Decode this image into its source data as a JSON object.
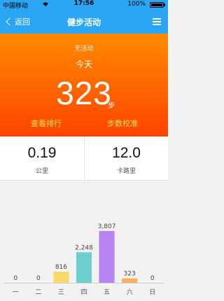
{
  "status_bar": {
    "carrier": "中国移动",
    "time": "17:56",
    "battery_percent": "100%"
  },
  "nav": {
    "back_label": "返回",
    "title": "健步活动"
  },
  "hero": {
    "activity_status": "无活动",
    "day_label": "今天",
    "steps": "323",
    "steps_unit": "步",
    "ranking_link": "查看排行",
    "calibrate_link": "步数校准"
  },
  "stats": {
    "distance_value": "0.19",
    "distance_label": "公里",
    "calories_value": "12.0",
    "calories_label": "卡路里"
  },
  "colors": {
    "nav_blue": "#2aa6f5",
    "hero_top": "#ff8a00",
    "hero_bottom": "#ff4500",
    "link_yellow": "#ffe34d"
  },
  "chart_data": {
    "type": "bar",
    "categories": [
      "一",
      "二",
      "三",
      "四",
      "五",
      "六",
      "日"
    ],
    "values": [
      0,
      0,
      816,
      2248,
      3807,
      323,
      0
    ],
    "value_labels": [
      "0",
      "0",
      "816",
      "2,248",
      "3,807",
      "323",
      "0"
    ],
    "colors": [
      "#cccccc",
      "#cccccc",
      "#f9d86b",
      "#6fcfcf",
      "#b785f2",
      "#f5b15b",
      "#cccccc"
    ],
    "ylim": [
      0,
      3807
    ]
  }
}
